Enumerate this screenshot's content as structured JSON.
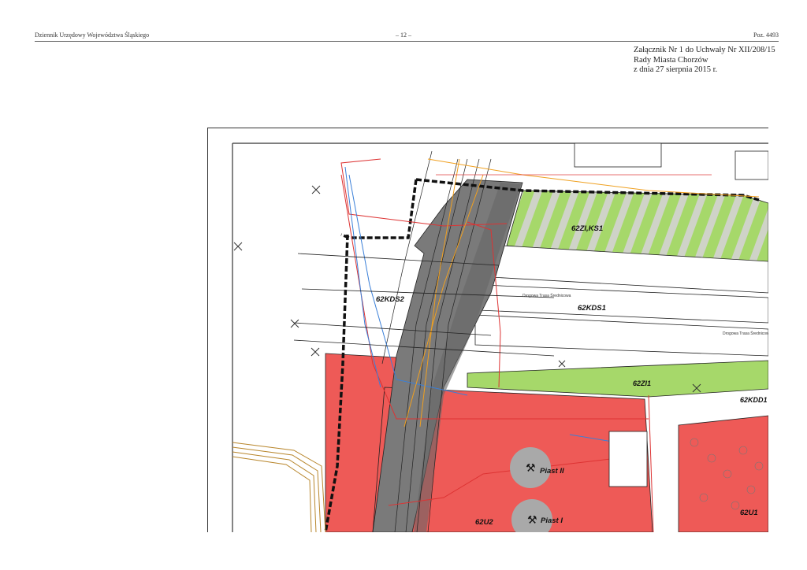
{
  "header": {
    "left": "Dziennik Urzędowy Województwa Śląskiego",
    "center": "– 12 –",
    "right": "Poz. 4493"
  },
  "annex": {
    "line1": "Załącznik Nr 1 do Uchwały Nr XII/208/15",
    "line2": "Rady Miasta Chorzów",
    "line3": "z dnia 27 sierpnia 2015 r."
  },
  "map": {
    "zones": {
      "zi_ks1": "62ZI,KS1",
      "kds2": "62KDS2",
      "kds1": "62KDS1",
      "zi1": "62ZI1",
      "kdd1": "62KDD1",
      "u2": "62U2",
      "u1": "62U1"
    },
    "roads": {
      "road1": "Drogowa Trasa Średnicowa",
      "road2": "Drogowa Trasa Średnicowa"
    },
    "pois": {
      "piast2": "Piast II",
      "piast1": "Piast I"
    },
    "colors": {
      "service_zone": "#ee5a57",
      "green_zone": "#a6d86a",
      "rail_zone": "#7a7a7a",
      "boundary": "#111111"
    }
  }
}
